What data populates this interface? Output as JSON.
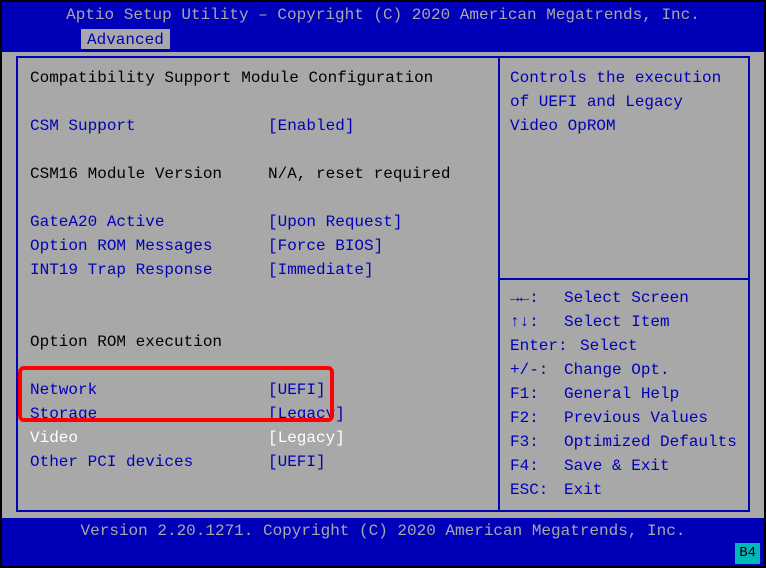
{
  "header": {
    "title": "Aptio Setup Utility – Copyright (C) 2020 American Megatrends, Inc."
  },
  "tab": {
    "label": "Advanced"
  },
  "section": {
    "title": "Compatibility Support Module Configuration",
    "csm_support": {
      "label": "CSM Support",
      "value": "[Enabled]"
    },
    "csm16_ver": {
      "label": "CSM16 Module Version",
      "value": "N/A, reset required"
    },
    "gate_a20": {
      "label": "GateA20 Active",
      "value": "[Upon Request]"
    },
    "oprom_msgs": {
      "label": "Option ROM Messages",
      "value": "[Force BIOS]"
    },
    "int19": {
      "label": "INT19 Trap Response",
      "value": "[Immediate]"
    },
    "oprom_exec_title": "Option ROM execution",
    "network": {
      "label": "Network",
      "value": "[UEFI]"
    },
    "storage": {
      "label": "Storage",
      "value": "[Legacy]"
    },
    "video": {
      "label": "Video",
      "value": "[Legacy]"
    },
    "other_pci": {
      "label": "Other PCI devices",
      "value": "[UEFI]"
    }
  },
  "help": {
    "desc_lines": [
      "Controls the execution",
      "of UEFI and Legacy",
      "Video OpROM"
    ],
    "keys": [
      {
        "key": "→←:",
        "action": "Select Screen"
      },
      {
        "key": "↑↓:",
        "action": "Select Item"
      },
      {
        "key": "Enter:",
        "action": "Select"
      },
      {
        "key": "+/-:",
        "action": "Change Opt."
      },
      {
        "key": "F1:",
        "action": "General Help"
      },
      {
        "key": "F2:",
        "action": "Previous Values"
      },
      {
        "key": "F3:",
        "action": "Optimized Defaults"
      },
      {
        "key": "F4:",
        "action": "Save & Exit"
      },
      {
        "key": "ESC:",
        "action": "Exit"
      }
    ]
  },
  "footer": {
    "text": "Version 2.20.1271. Copyright (C) 2020 American Megatrends, Inc.",
    "badge": "B4"
  }
}
